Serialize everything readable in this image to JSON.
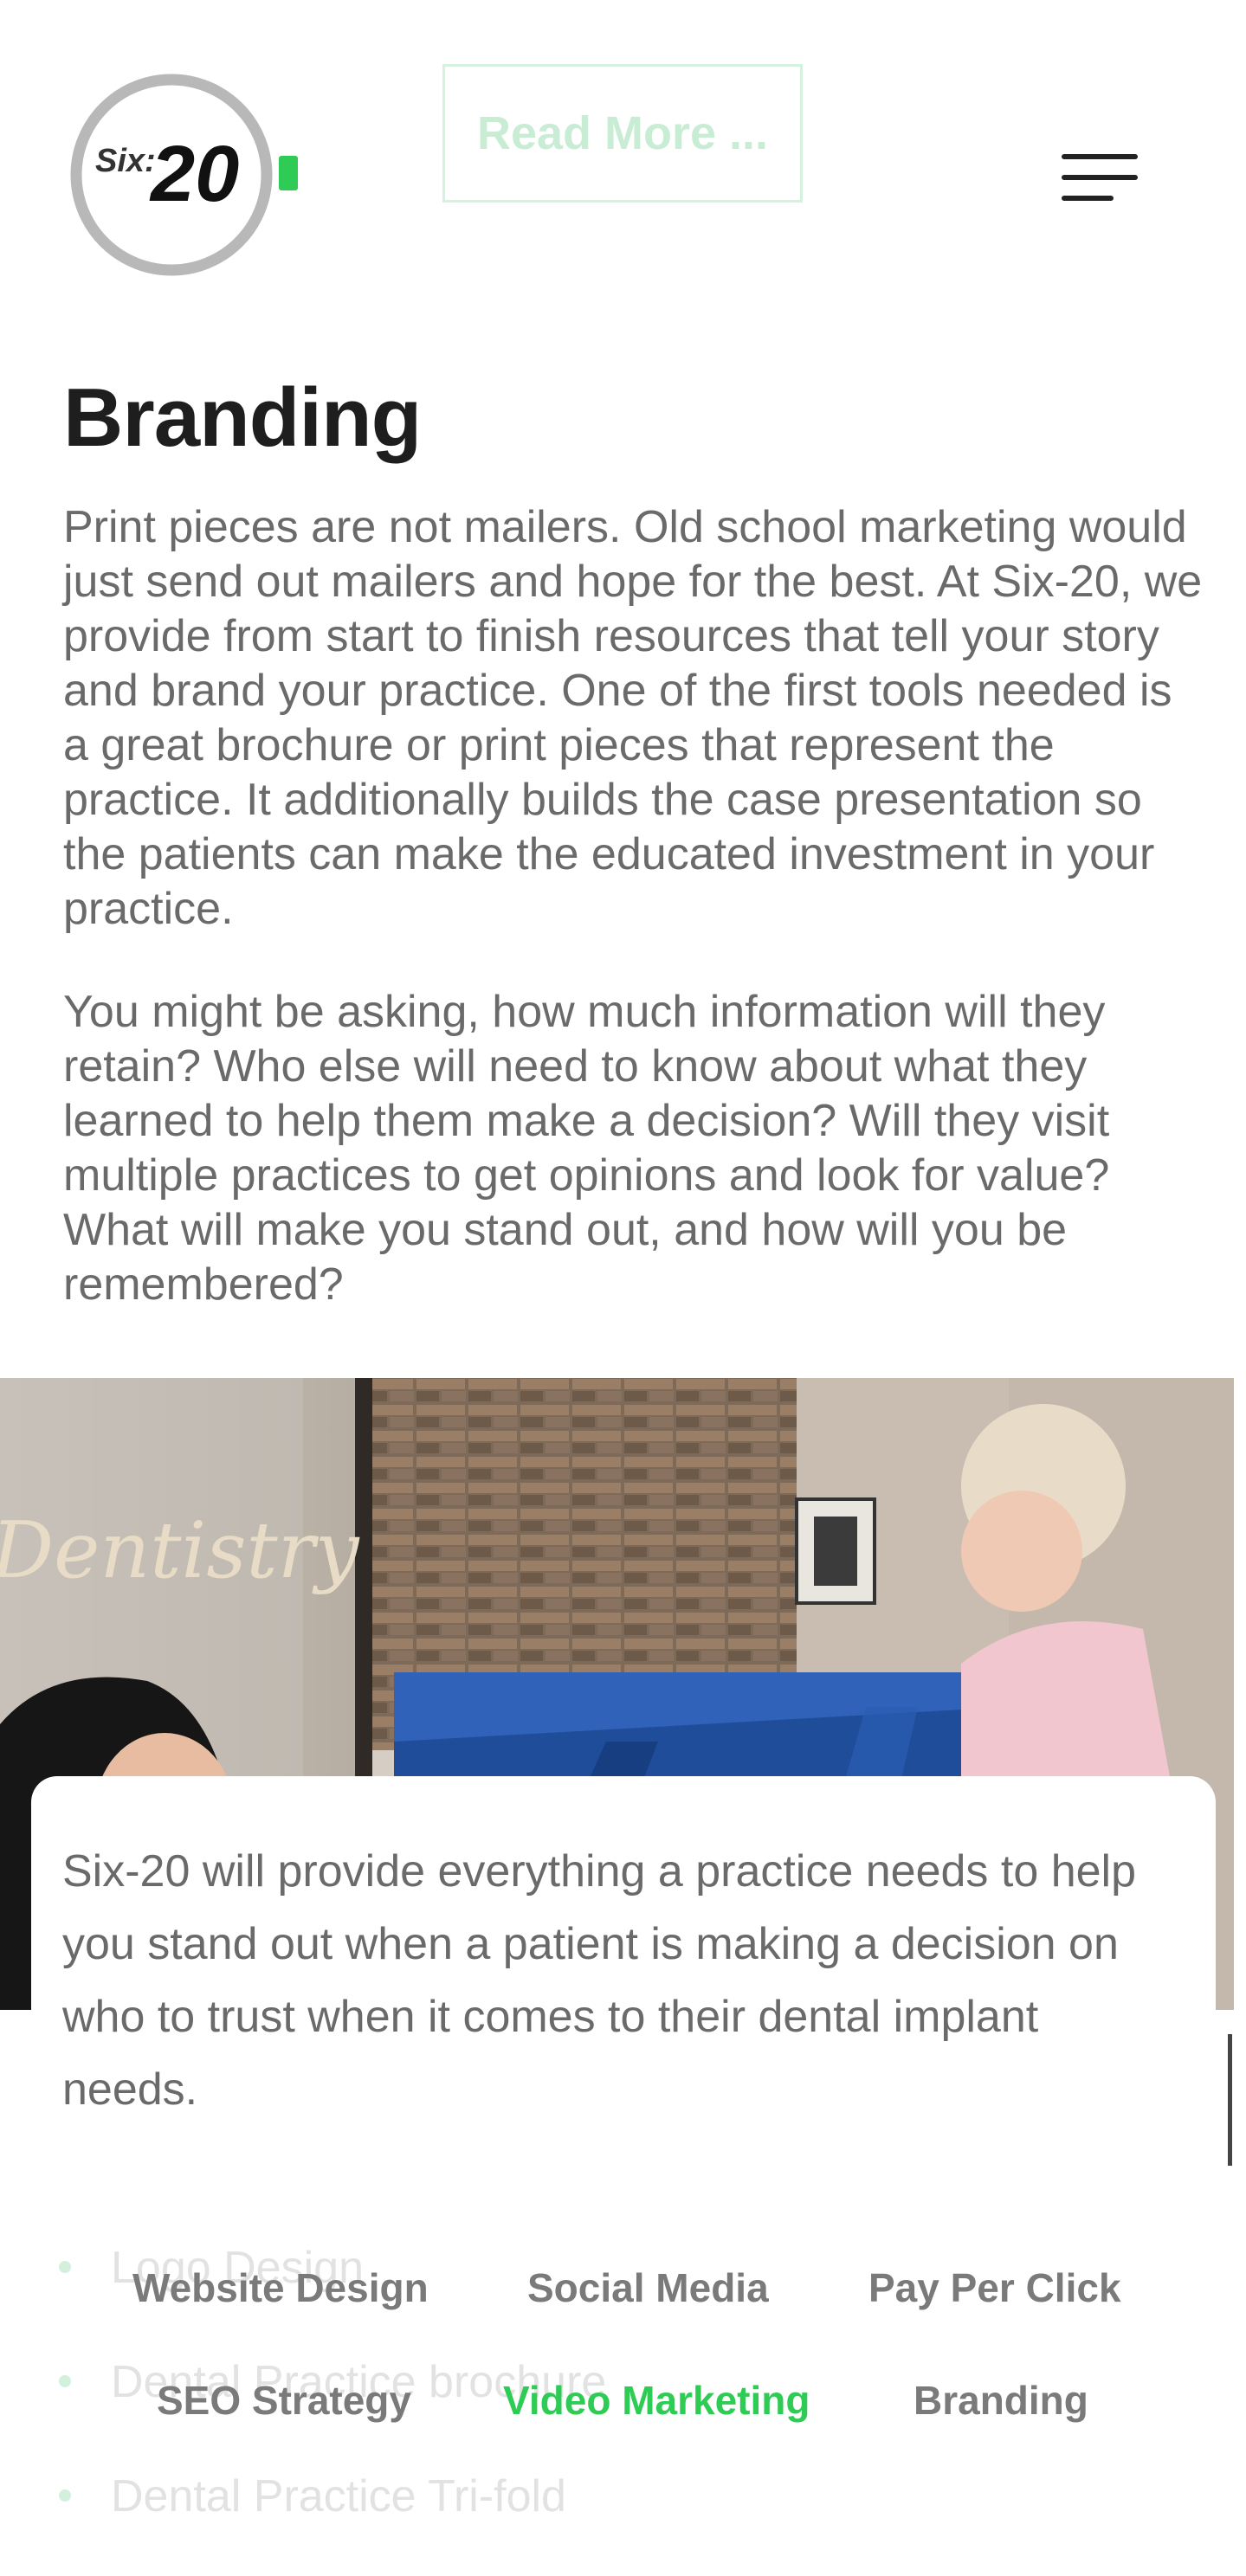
{
  "header": {
    "logo_text_small": "Six:",
    "logo_text_big": "20",
    "read_more_label": "Read More ..."
  },
  "main": {
    "title": "Branding",
    "paragraphs": [
      "Print pieces are not mailers. Old school marketing would just send out mailers and hope for the best. At Six-20, we provide from start to finish resources that tell your story and brand your practice. One of the first tools needed is a great brochure or print pieces that represent the practice. It additionally builds the case presentation so the patients can make the educated investment in your practice.",
      "You might be asking, how much information will they retain? Who else will need to know about what they learned to help them make a decision? Will they visit multiple practices to get opinions and look for value? What will make you stand out, and how will you be remembered?"
    ],
    "photo_sign_text": "Dentistry",
    "card_text": "Six-20 will provide everything a practice needs to help you stand out when a patient is making a decision on who to trust when it comes to their dental implant needs.",
    "list_items": [
      "Logo Design",
      "Dental Practice brochure",
      "Dental Practice Tri-fold"
    ]
  },
  "services_nav": {
    "items": [
      {
        "label": "Website Design",
        "active": false
      },
      {
        "label": "Social Media",
        "active": false
      },
      {
        "label": "Pay Per Click",
        "active": false
      },
      {
        "label": "SEO Strategy",
        "active": false
      },
      {
        "label": "Video Marketing",
        "active": true
      },
      {
        "label": "Branding",
        "active": false
      }
    ]
  },
  "colors": {
    "accent": "#2ecc55",
    "heading": "#1e1e1e",
    "body_text": "#6a6a6a"
  }
}
